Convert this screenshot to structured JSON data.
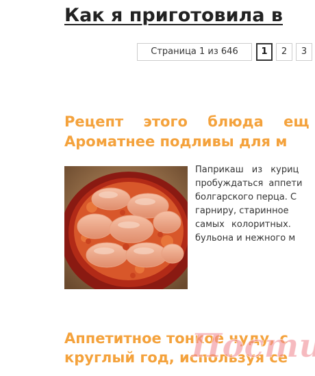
{
  "header": {
    "title": "Как я приготовила в"
  },
  "pagination": {
    "info": "Страница 1 из 646",
    "pages": [
      "1",
      "2",
      "3"
    ],
    "current": "1"
  },
  "posts": [
    {
      "title_lines": [
        "Рецепт этого блюда ещ",
        "Ароматнее подливы для м"
      ],
      "excerpt_lines": [
        "Паприкаш из куриц",
        "пробуждаться аппети",
        "болгарского перца. С",
        "гарниру, старинное",
        "самых колоритных.",
        "бульона и нежного м"
      ]
    },
    {
      "title_lines": [
        "Аппетитное тонкое чуду, с",
        "круглый год, используя се"
      ]
    }
  ],
  "watermark": {
    "text": "Постила"
  },
  "colors": {
    "post_title": "#f4a23c",
    "watermark": "#f08c95"
  }
}
